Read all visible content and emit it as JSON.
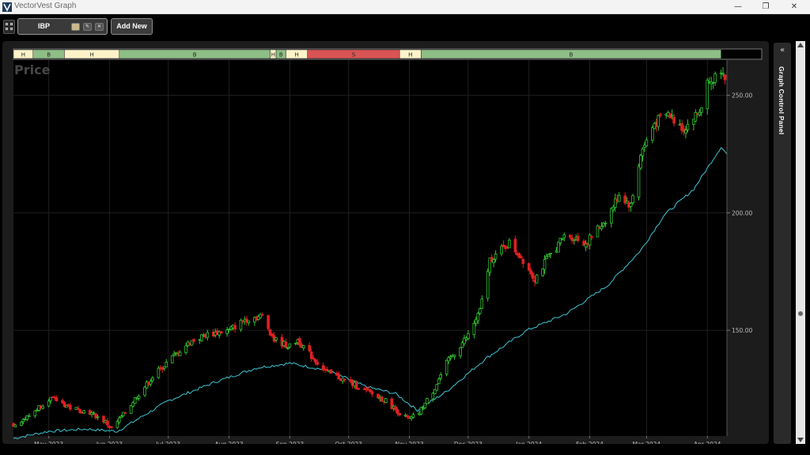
{
  "window": {
    "title": "VectorVest Graph"
  },
  "toolbar": {
    "ticker": "IBP",
    "add_new_label": "Add New"
  },
  "side_panel": {
    "label": "Graph Control Panel"
  },
  "colors": {
    "up": "#30c830",
    "down": "#e02020",
    "ma": "#3ec5d4",
    "buy": "#8ebf86",
    "hold": "#fcf3c9",
    "sell": "#d95454"
  },
  "chart_data": {
    "type": "candlestick",
    "title": "Price",
    "ylim": [
      105,
      265
    ],
    "yticks": [
      150,
      200,
      250
    ],
    "ytick_labels": [
      "150.00",
      "200.00",
      "250.00"
    ],
    "xtick_labels": [
      "May 2023",
      "Jun 2023",
      "Jul 2023",
      "Aug 2023",
      "Sep 2023",
      "Oct 2023",
      "Nov 2023",
      "Dec 2023",
      "Jan 2024",
      "Feb 2024",
      "Mar 2024",
      "Apr 2024"
    ],
    "xtick_dates": [
      "2023-05-01",
      "2023-06-01",
      "2023-07-01",
      "2023-08-01",
      "2023-09-01",
      "2023-10-01",
      "2023-11-01",
      "2023-12-01",
      "2024-01-01",
      "2024-02-01",
      "2024-03-01",
      "2024-04-01"
    ],
    "xlim": [
      "2023-04-13",
      "2024-04-11"
    ],
    "signals": [
      {
        "label": "H",
        "start": "2023-04-13",
        "end": "2023-04-23"
      },
      {
        "label": "B",
        "start": "2023-04-23",
        "end": "2023-05-09"
      },
      {
        "label": "H",
        "start": "2023-05-09",
        "end": "2023-06-06"
      },
      {
        "label": "B",
        "start": "2023-06-06",
        "end": "2023-08-22"
      },
      {
        "label": "H",
        "start": "2023-08-22",
        "end": "2023-08-25"
      },
      {
        "label": "B",
        "start": "2023-08-25",
        "end": "2023-08-30"
      },
      {
        "label": "H",
        "start": "2023-08-30",
        "end": "2023-09-10"
      },
      {
        "label": "S",
        "start": "2023-09-10",
        "end": "2023-10-27"
      },
      {
        "label": "H",
        "start": "2023-10-27",
        "end": "2023-11-07"
      },
      {
        "label": "B",
        "start": "2023-11-07",
        "end": "2024-04-08"
      }
    ],
    "anchors": [
      [
        "2023-04-13",
        110
      ],
      [
        "2023-04-20",
        113
      ],
      [
        "2023-05-01",
        121
      ],
      [
        "2023-05-06",
        120
      ],
      [
        "2023-05-12",
        117
      ],
      [
        "2023-05-22",
        115
      ],
      [
        "2023-05-30",
        111
      ],
      [
        "2023-06-02",
        108
      ],
      [
        "2023-06-08",
        114
      ],
      [
        "2023-06-15",
        122
      ],
      [
        "2023-06-25",
        132
      ],
      [
        "2023-07-05",
        140
      ],
      [
        "2023-07-12",
        145
      ],
      [
        "2023-07-20",
        148
      ],
      [
        "2023-08-01",
        150
      ],
      [
        "2023-08-10",
        155
      ],
      [
        "2023-08-18",
        156
      ],
      [
        "2023-08-24",
        146
      ],
      [
        "2023-09-01",
        143
      ],
      [
        "2023-09-05",
        146
      ],
      [
        "2023-09-12",
        139
      ],
      [
        "2023-09-20",
        132
      ],
      [
        "2023-10-01",
        128
      ],
      [
        "2023-10-10",
        124
      ],
      [
        "2023-10-20",
        120
      ],
      [
        "2023-10-28",
        114
      ],
      [
        "2023-11-01",
        112
      ],
      [
        "2023-11-06",
        115
      ],
      [
        "2023-11-13",
        124
      ],
      [
        "2023-11-20",
        136
      ],
      [
        "2023-12-01",
        148
      ],
      [
        "2023-12-07",
        158
      ],
      [
        "2023-12-12",
        180
      ],
      [
        "2023-12-22",
        187
      ],
      [
        "2023-12-29",
        180
      ],
      [
        "2024-01-04",
        172
      ],
      [
        "2024-01-10",
        180
      ],
      [
        "2024-01-20",
        191
      ],
      [
        "2024-01-30",
        187
      ],
      [
        "2024-02-10",
        198
      ],
      [
        "2024-02-16",
        208
      ],
      [
        "2024-02-22",
        203
      ],
      [
        "2024-02-27",
        225
      ],
      [
        "2024-03-05",
        238
      ],
      [
        "2024-03-12",
        242
      ],
      [
        "2024-03-20",
        236
      ],
      [
        "2024-03-28",
        243
      ],
      [
        "2024-04-02",
        258
      ],
      [
        "2024-04-10",
        257
      ]
    ],
    "ma_anchors": [
      [
        "2023-04-13",
        104
      ],
      [
        "2023-05-01",
        107
      ],
      [
        "2023-05-20",
        108
      ],
      [
        "2023-06-05",
        107
      ],
      [
        "2023-07-01",
        120
      ],
      [
        "2023-07-25",
        128
      ],
      [
        "2023-08-15",
        134
      ],
      [
        "2023-09-01",
        136
      ],
      [
        "2023-09-20",
        133
      ],
      [
        "2023-10-10",
        126
      ],
      [
        "2023-10-25",
        123
      ],
      [
        "2023-11-05",
        116
      ],
      [
        "2023-11-20",
        124
      ],
      [
        "2023-12-10",
        138
      ],
      [
        "2023-12-31",
        150
      ],
      [
        "2024-01-20",
        157
      ],
      [
        "2024-02-10",
        169
      ],
      [
        "2024-02-27",
        184
      ],
      [
        "2024-03-10",
        199
      ],
      [
        "2024-03-25",
        210
      ],
      [
        "2024-04-08",
        228
      ],
      [
        "2024-04-11",
        225
      ]
    ]
  }
}
